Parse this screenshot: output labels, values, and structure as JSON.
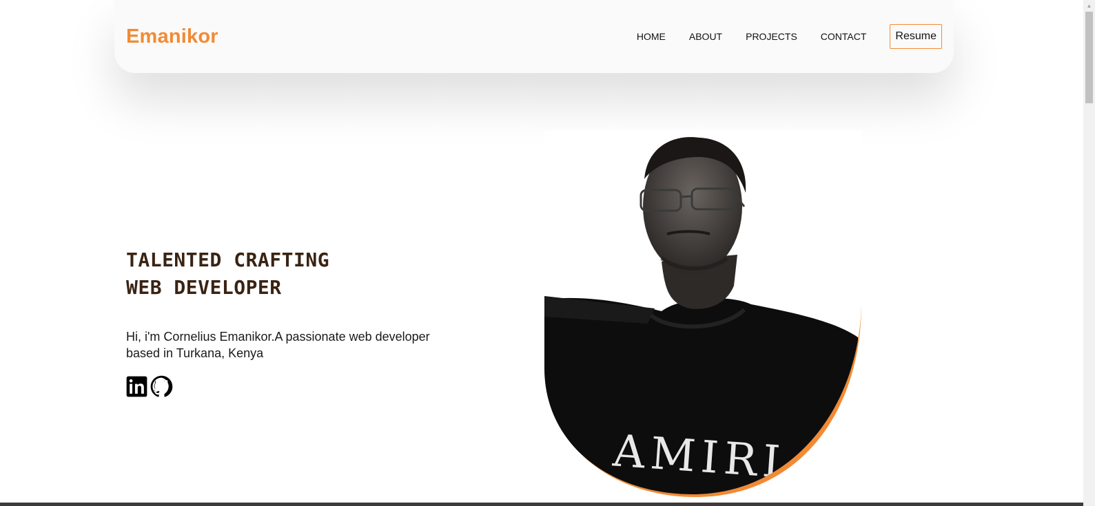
{
  "colors": {
    "accent": "#f28a33",
    "heading": "#3a2313",
    "text": "#1a1a1a"
  },
  "nav": {
    "brand": "Emanikor",
    "links": [
      "HOME",
      "ABOUT",
      "PROJECTS",
      "CONTACT"
    ],
    "resume_label": "Resume"
  },
  "hero": {
    "title_line1": "TALENTED CRAFTING",
    "title_line2": "WEB DEVELOPER",
    "description": "Hi, i'm Cornelius Emanikor.A passionate web developer based in Turkana, Kenya",
    "socials": [
      {
        "icon": "linkedin-icon"
      },
      {
        "icon": "github-icon"
      }
    ],
    "portrait_shirt_text": "AMIRI"
  }
}
